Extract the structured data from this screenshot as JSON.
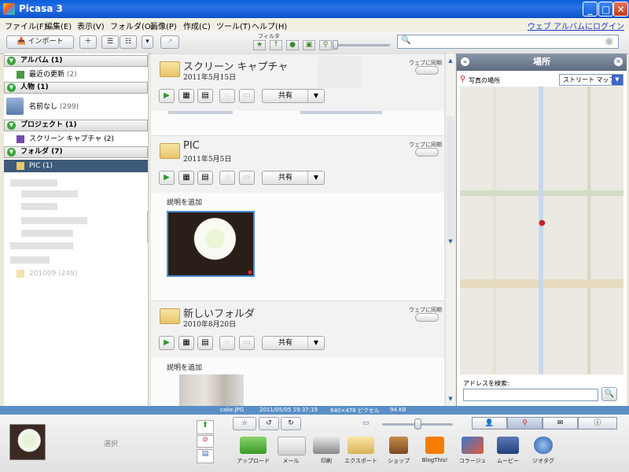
{
  "window": {
    "title": "Picasa 3"
  },
  "menu": {
    "items": [
      "ファイル(F)",
      "編集(E)",
      "表示(V)",
      "フォルダ(O)",
      "画像(P)",
      "作成(C)",
      "ツール(T)",
      "ヘルプ(H)"
    ],
    "web_link": "ウェブ アルバムにログイン"
  },
  "toolbar": {
    "import_label": "インポート",
    "filter_label": "フィルタ",
    "search_placeholder": ""
  },
  "sidebar": {
    "sections": [
      {
        "label": "アルバム (1)",
        "items": [
          {
            "label": "最近の更新",
            "count": "(2)"
          }
        ]
      },
      {
        "label": "人物 (1)",
        "items": [
          {
            "label": "名前なし",
            "count": "(299)"
          }
        ]
      },
      {
        "label": "プロジェクト (1)",
        "items": [
          {
            "label": "スクリーン キャプチャ",
            "count": "(2)"
          }
        ]
      },
      {
        "label": "フォルダ (7)",
        "items": [
          {
            "label": "PIC",
            "count": "(1)"
          }
        ]
      }
    ],
    "bottom_folder": "201009 (249)"
  },
  "albums": [
    {
      "title": "スクリーン キャプチャ",
      "date": "2011年5月15日",
      "sync": "ウェブに同期",
      "share": "共有"
    },
    {
      "title": "PIC",
      "date": "2011年5月5日",
      "sync": "ウェブに同期",
      "share": "共有",
      "description": "説明を追加"
    },
    {
      "title": "新しいフォルダ",
      "date": "2010年8月20日",
      "sync": "ウェブに同期",
      "share": "共有",
      "description": "説明を追加"
    }
  ],
  "right_panel": {
    "title": "場所",
    "photo_location_label": "写真の場所",
    "map_type": "ストリート マップ",
    "address_search_label": "アドレスを検索:"
  },
  "status": {
    "filename": "cake.JPG",
    "datetime": "2011/05/05 19:37:19",
    "dimensions": "640×478 ピクセル",
    "size": "94 KB"
  },
  "tray": {
    "select_label": "選択",
    "actions": [
      "アップロード",
      "メール",
      "印刷",
      "エクスポート",
      "ショップ",
      "BlogThis!",
      "コラージュ",
      "ムービー",
      "ジオタグ"
    ]
  },
  "colors": {
    "accent": "#3aa33a",
    "selection": "#3d5a7a",
    "statusbar": "#5a8fc6"
  }
}
